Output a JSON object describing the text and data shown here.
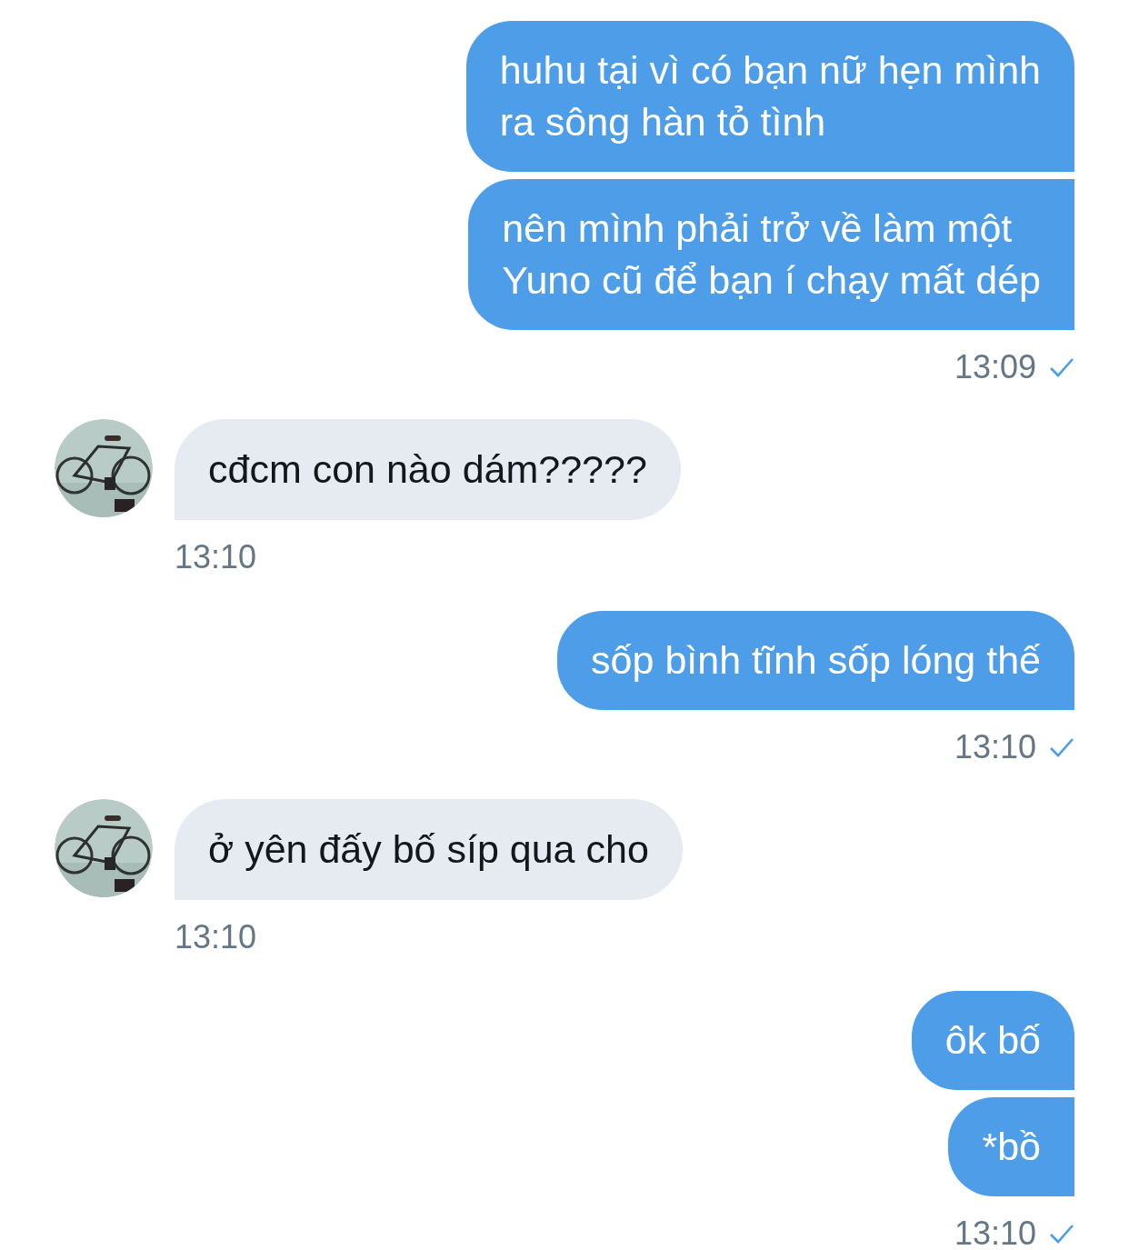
{
  "groups": [
    {
      "kind": "sent",
      "messages": [
        "huhu tại vì có bạn nữ hẹn mình\nra sông hàn tỏ tình",
        "nên mình phải trở về làm một\nYuno cũ để bạn í chạy mất dép"
      ],
      "time": "13:09",
      "read": true
    },
    {
      "kind": "received",
      "avatar": {
        "kind": "picture"
      },
      "messages": [
        "cđcm con nào dám?????"
      ],
      "time": "13:10"
    },
    {
      "kind": "sent",
      "messages": [
        "sốp bình tĩnh sốp lóng thế"
      ],
      "time": "13:10",
      "read": true
    },
    {
      "kind": "received",
      "avatar": {
        "kind": "picture"
      },
      "messages": [
        "ở yên đấy bố síp qua cho"
      ],
      "time": "13:10"
    },
    {
      "kind": "sent",
      "messages": [
        "ôk bố",
        "*bồ"
      ],
      "time": "13:10",
      "read": true
    }
  ]
}
